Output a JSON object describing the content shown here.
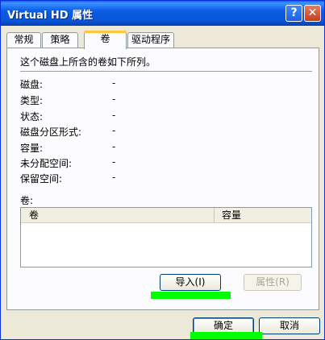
{
  "window": {
    "title": "Virtual HD 属性",
    "help_icon": "?",
    "close_icon": "✕"
  },
  "tabs": [
    {
      "label": "常规"
    },
    {
      "label": "策略"
    },
    {
      "label": "卷"
    },
    {
      "label": "驱动程序"
    }
  ],
  "volumes_tab": {
    "description": "这个磁盘上所含的卷如下所列。",
    "fields": [
      {
        "label": "磁盘:",
        "value": "-"
      },
      {
        "label": "类型:",
        "value": "-"
      },
      {
        "label": "状态:",
        "value": "-"
      },
      {
        "label": "磁盘分区形式:",
        "value": "-"
      },
      {
        "label": "容量:",
        "value": "-"
      },
      {
        "label": "未分配空间:",
        "value": "-"
      },
      {
        "label": "保留空间:",
        "value": "-"
      }
    ],
    "volume_list_label": "卷:",
    "columns": [
      "卷",
      "容量"
    ],
    "import_button": "导入(I)",
    "properties_button": "属性(R)"
  },
  "footer": {
    "ok_button": "确定",
    "cancel_button": "取消"
  },
  "colors": {
    "title_bar": "#0a55d8",
    "highlight": "#00ff00"
  }
}
